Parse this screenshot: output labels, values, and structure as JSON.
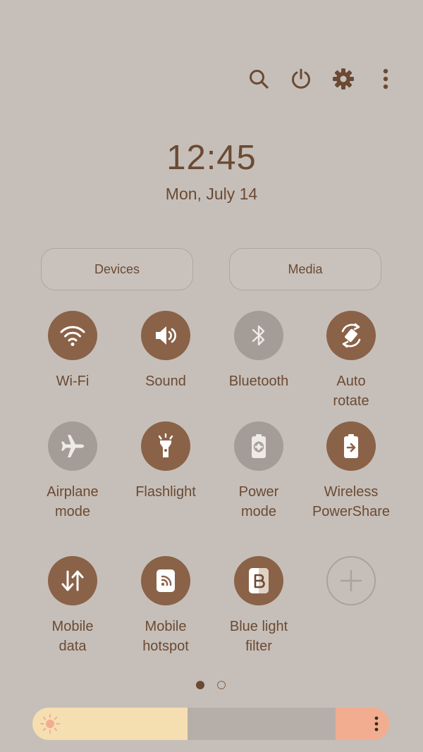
{
  "header": {
    "icons": [
      "search-icon",
      "power-icon",
      "settings-gear-icon",
      "more-vertical-icon"
    ]
  },
  "clock": {
    "time": "12:45",
    "date": "Mon, July 14"
  },
  "buttons": {
    "devices": "Devices",
    "media": "Media"
  },
  "tiles": [
    {
      "label": "Wi-Fi",
      "state": "on",
      "icon": "wifi-icon"
    },
    {
      "label": "Sound",
      "state": "on",
      "icon": "sound-icon"
    },
    {
      "label": "Bluetooth",
      "state": "off",
      "icon": "bluetooth-icon"
    },
    {
      "label": "Auto\nrotate",
      "state": "on",
      "icon": "auto-rotate-icon"
    },
    {
      "label": "Airplane\nmode",
      "state": "off",
      "icon": "airplane-icon"
    },
    {
      "label": "Flashlight",
      "state": "on",
      "icon": "flashlight-icon"
    },
    {
      "label": "Power\nmode",
      "state": "off",
      "icon": "power-mode-icon"
    },
    {
      "label": "Wireless\nPowerShare",
      "state": "on",
      "icon": "wireless-powershare-icon"
    },
    {
      "label": "Mobile\ndata",
      "state": "on",
      "icon": "mobile-data-icon"
    },
    {
      "label": "Mobile\nhotspot",
      "state": "on",
      "icon": "mobile-hotspot-icon"
    },
    {
      "label": "Blue light\nfilter",
      "state": "on",
      "icon": "blue-light-filter-icon"
    },
    {
      "label": "",
      "state": "add",
      "icon": "add-icon"
    }
  ],
  "pager": {
    "current_page": 1,
    "page_count": 2
  },
  "brightness": {
    "level_fraction": 0.45,
    "colors": {
      "fill": "#f5dfb1",
      "track": "#b6aea8",
      "end": "#f2ad91"
    }
  },
  "colors": {
    "background": "#c6bfb9",
    "accent": "#8a6248",
    "text": "#6b4a33",
    "inactive": "#a39c97"
  }
}
